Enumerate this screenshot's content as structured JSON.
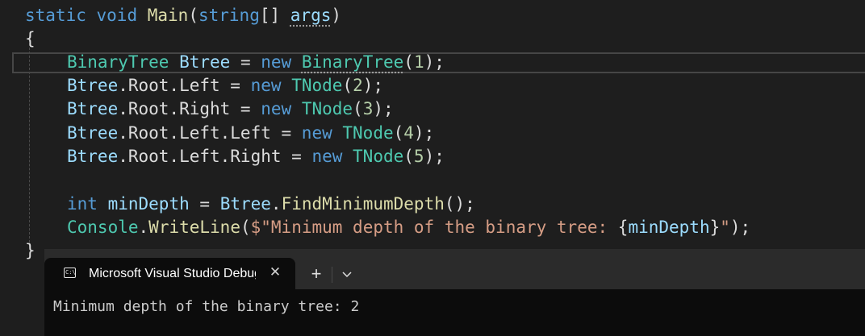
{
  "editor": {
    "line1": {
      "static": "static",
      "void": "void",
      "main": "Main",
      "open": "(",
      "string": "string",
      "brackets": "[] ",
      "args": "args",
      "close": ")"
    },
    "line2": {
      "brace": "{"
    },
    "line3": {
      "type1": "BinaryTree",
      "var": "Btree",
      "assign": " = ",
      "new": "new",
      "type2": "BinaryTree",
      "open": "(",
      "num": "1",
      "close": ");"
    },
    "line4": {
      "var": "Btree",
      "access": ".Root.Left = ",
      "new": "new",
      "type": "TNode",
      "open": "(",
      "num": "2",
      "close": ");"
    },
    "line5": {
      "var": "Btree",
      "access": ".Root.Right = ",
      "new": "new",
      "type": "TNode",
      "open": "(",
      "num": "3",
      "close": ");"
    },
    "line6": {
      "var": "Btree",
      "access": ".Root.Left.Left = ",
      "new": "new",
      "type": "TNode",
      "open": "(",
      "num": "4",
      "close": ");"
    },
    "line7": {
      "var": "Btree",
      "access": ".Root.Left.Right = ",
      "new": "new",
      "type": "TNode",
      "open": "(",
      "num": "5",
      "close": ");"
    },
    "line9": {
      "int": "int",
      "var": "minDepth",
      "assign": " = ",
      "obj": "Btree",
      "dot": ".",
      "method": "FindMinimumDepth",
      "rest": "();"
    },
    "line10": {
      "console": "Console",
      "dot": ".",
      "method": "WriteLine",
      "open": "(",
      "str1": "$\"Minimum depth of the binary tree: ",
      "brace_open": "{",
      "var": "minDepth",
      "brace_close": "}",
      "str2": "\"",
      "close": ");"
    },
    "line11": {
      "brace": "}"
    }
  },
  "terminal": {
    "tab_title": "Microsoft Visual Studio Debug Console",
    "tab_icon_glyph": "C:\\",
    "close_glyph": "✕",
    "new_tab_glyph": "+",
    "output": "Minimum depth of the binary tree: 2"
  },
  "icons": {
    "tab_icon": "console-icon",
    "close": "close-icon",
    "new_tab": "plus-icon",
    "dropdown": "chevron-down-icon"
  },
  "colors": {
    "background": "#1e1e1e",
    "keyword": "#569cd6",
    "type": "#4ec9b0",
    "method": "#dcdcaa",
    "identifier": "#9cdcfe",
    "number": "#b5cea8",
    "string": "#d69d85",
    "terminal_bg": "#0c0c0c",
    "titlebar_bg": "#2b2b2b"
  }
}
